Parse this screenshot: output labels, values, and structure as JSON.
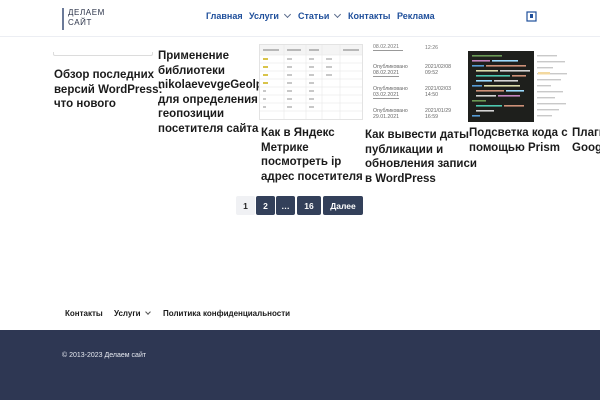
{
  "site": {
    "logo_line1": "ДЕЛАЕМ",
    "logo_line2": "САЙТ"
  },
  "nav": {
    "items": [
      {
        "label": "Главная"
      },
      {
        "label": "Услуги"
      },
      {
        "label": "Статьи"
      },
      {
        "label": "Контакты"
      },
      {
        "label": "Реклама"
      }
    ]
  },
  "posts": [
    {
      "title_lines": [
        "Обзор последних",
        "версий WordPress:",
        "что нового"
      ]
    },
    {
      "title_lines": [
        "Применение",
        "библиотеки",
        "nikolaevevgeGeolp",
        "для определения",
        "геопозиции",
        "посетителя сайта"
      ]
    },
    {
      "title_lines": [
        "Как в Яндекс",
        "Метрике",
        "посмотреть ip",
        "адрес посетителя"
      ]
    },
    {
      "title_lines": [
        "Как вывести даты",
        "публикации и",
        "обновления записи",
        "в WordPress"
      ]
    },
    {
      "title_lines": [
        "Подсветка кода с",
        "помощью Prism"
      ]
    },
    {
      "title_lines": [
        "Плаги",
        "Googl"
      ]
    }
  ],
  "thumb_wp_dates": {
    "rows": [
      {
        "status": "Опубликовано",
        "date": "08.02.2021",
        "date2": "2021/02/08",
        "time": "09:52"
      },
      {
        "status": "Опубликовано",
        "date": "03.02.2021",
        "date2": "2021/02/03",
        "time": "14:50"
      },
      {
        "status": "Опубликовано",
        "date": "29.01.2021",
        "date2": "2021/01/29",
        "time": "16:59"
      }
    ]
  },
  "pagination": {
    "current": "1",
    "page2": "2",
    "ellipsis": "…",
    "last": "16",
    "next": "Далее"
  },
  "footer_nav": {
    "items": [
      {
        "label": "Контакты"
      },
      {
        "label": "Услуги"
      },
      {
        "label": "Политика конфиденциальности"
      }
    ]
  },
  "footer": {
    "copyright": "© 2013-2023 Делаем сайт"
  },
  "colors": {
    "nav_link": "#1f4f9b",
    "footer_bg": "#2e3753",
    "pager_bg": "#33405a"
  }
}
